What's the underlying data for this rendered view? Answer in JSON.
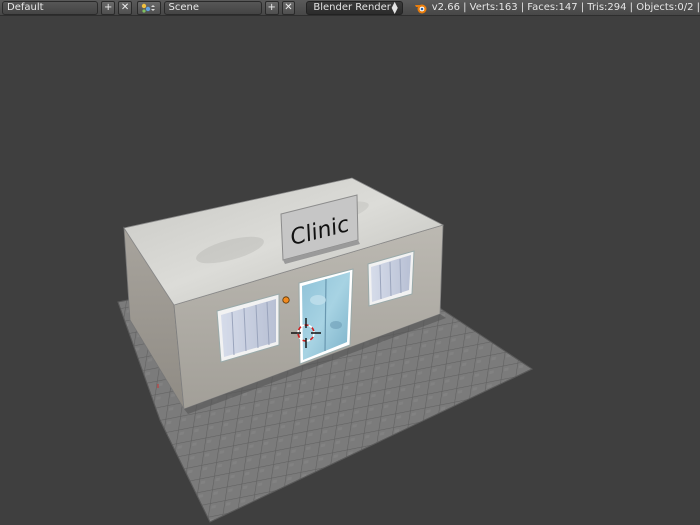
{
  "header": {
    "layout_name": "Default",
    "scene_name": "Scene",
    "render_engine": "Blender Render",
    "stats": "v2.66 | Verts:163 | Faces:147 | Tris:294 | Objects:0/2 |"
  },
  "icons": {
    "add": "plus-icon",
    "remove": "x-icon",
    "scene": "scene-icon",
    "blender": "blender-logo-icon",
    "arrows": "up-down-arrows-icon"
  },
  "viewport": {
    "sign_text": "Clinic"
  },
  "colors": {
    "background": "#3f3f3f",
    "header": "#4a4a4a",
    "blender_orange": "#e87d0d"
  }
}
